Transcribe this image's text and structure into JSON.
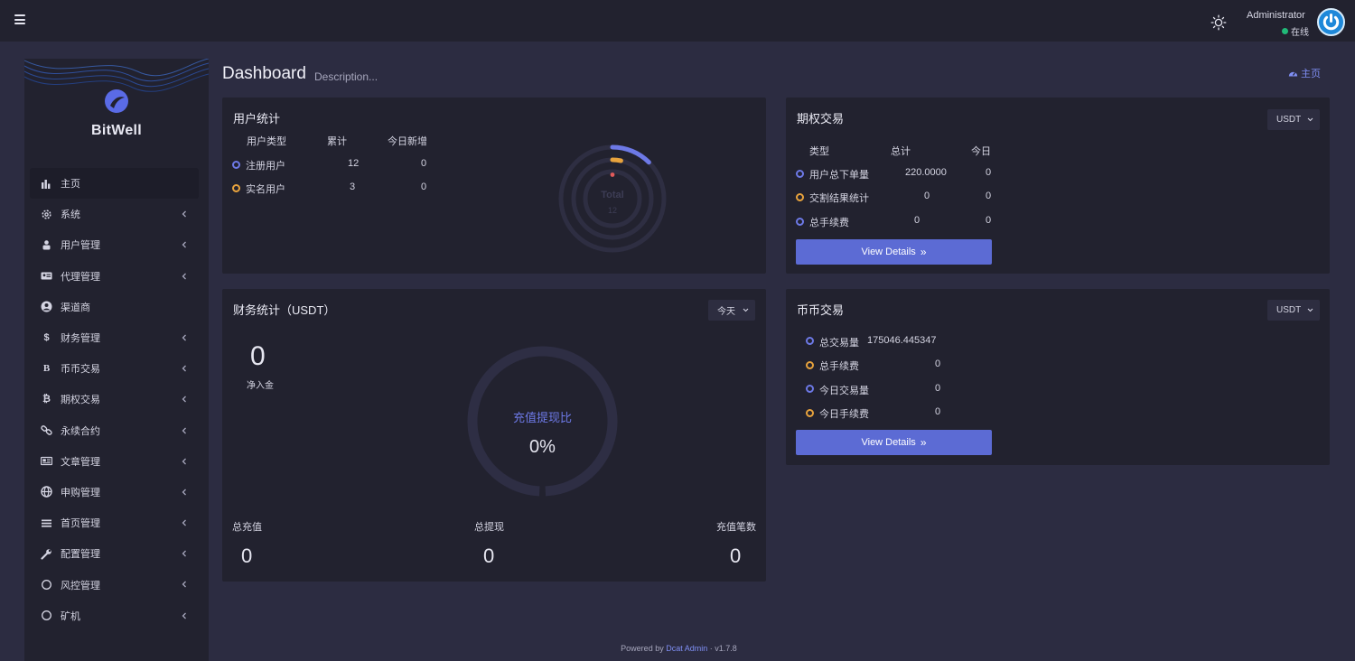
{
  "header": {
    "admin_name": "Administrator",
    "status": "在线",
    "status_color": "#21b978"
  },
  "sidebar": {
    "logo_text": "BitWell",
    "items": [
      {
        "label": "主页",
        "icon": "bar-chart-icon",
        "active": true
      },
      {
        "label": "系统",
        "icon": "gear-icon"
      },
      {
        "label": "用户管理",
        "icon": "users-icon"
      },
      {
        "label": "代理管理",
        "icon": "id-card-icon"
      },
      {
        "label": "渠道商",
        "icon": "user-circle-icon"
      },
      {
        "label": "财务管理",
        "icon": "dollar-icon"
      },
      {
        "label": "币币交易",
        "icon": "bold-b-icon"
      },
      {
        "label": "期权交易",
        "icon": "bitcoin-icon"
      },
      {
        "label": "永续合约",
        "icon": "link-icon"
      },
      {
        "label": "文章管理",
        "icon": "newspaper-icon"
      },
      {
        "label": "申购管理",
        "icon": "globe-icon"
      },
      {
        "label": "首页管理",
        "icon": "list-icon"
      },
      {
        "label": "配置管理",
        "icon": "wrench-icon"
      },
      {
        "label": "风控管理",
        "icon": "circle-icon"
      },
      {
        "label": "矿机",
        "icon": "circle-icon"
      }
    ]
  },
  "page": {
    "title": "Dashboard",
    "description": "Description...",
    "home_link": "主页"
  },
  "user_stats": {
    "title": "用户统计",
    "headers": [
      "用户类型",
      "累计",
      "今日新增"
    ],
    "rows": [
      {
        "label": "注册用户",
        "total": "12",
        "today": "0"
      },
      {
        "label": "实名用户",
        "total": "3",
        "today": "0"
      }
    ],
    "chart_label": "Total",
    "chart_value": "12"
  },
  "options_trading": {
    "title": "期权交易",
    "currency": "USDT",
    "headers": [
      "类型",
      "总计",
      "今日"
    ],
    "rows": [
      {
        "label": "用户总下单量",
        "total": "220.0000",
        "today": "0"
      },
      {
        "label": "交割结果统计",
        "total": "0",
        "today": "0"
      },
      {
        "label": "总手续费",
        "total": "0",
        "today": "0"
      }
    ],
    "button": "View Details"
  },
  "finance": {
    "title": "财务统计（USDT）",
    "period": "今天",
    "net_value": "0",
    "net_label": "净入金",
    "ratio_label": "充值提现比",
    "ratio_value": "0%",
    "ratio_fraction": 0,
    "stats": [
      {
        "label": "总充值",
        "value": "0"
      },
      {
        "label": "总提现",
        "value": "0"
      },
      {
        "label": "充值笔数",
        "value": "0"
      }
    ]
  },
  "coin_trading": {
    "title": "币币交易",
    "currency": "USDT",
    "rows": [
      {
        "label": "总交易量",
        "value": "175046.445347"
      },
      {
        "label": "总手续费",
        "value": "0"
      },
      {
        "label": "今日交易量",
        "value": "0"
      },
      {
        "label": "今日手续费",
        "value": "0"
      }
    ],
    "button": "View Details"
  },
  "footer": {
    "powered_by": "Powered by",
    "link": "Dcat Admin",
    "sep": "·",
    "version": "v1.7.8"
  },
  "colors": {
    "accent": "#5c6bd4",
    "blue_ring": "#6d79e6",
    "orange_ring": "#e8a33d"
  }
}
